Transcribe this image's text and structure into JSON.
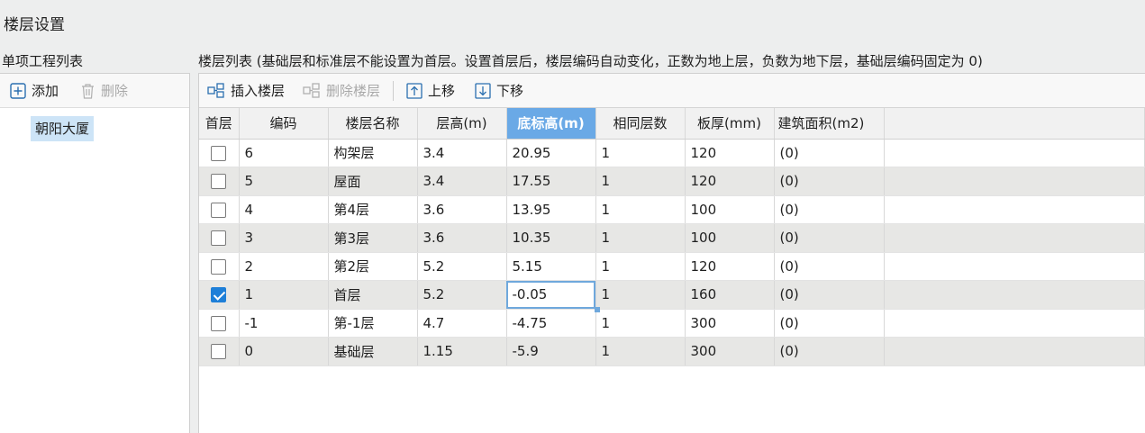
{
  "window": {
    "title": "楼层设置"
  },
  "left": {
    "title": "单项工程列表",
    "toolbar": {
      "add": "添加",
      "delete": "删除"
    },
    "items": [
      "朝阳大厦"
    ]
  },
  "right": {
    "title": "楼层列表 (基础层和标准层不能设置为首层。设置首层后，楼层编码自动变化，正数为地上层，负数为地下层，基础层编码固定为 0)",
    "toolbar": {
      "insert": "插入楼层",
      "delete": "删除楼层",
      "up": "上移",
      "down": "下移"
    },
    "columns": [
      "首层",
      "编码",
      "楼层名称",
      "层高(m)",
      "底标高(m)",
      "相同层数",
      "板厚(mm)",
      "建筑面积(m2)"
    ],
    "rows": [
      {
        "first": false,
        "code": "6",
        "name": "构架层",
        "height": "3.4",
        "base": "20.95",
        "same": "1",
        "slab": "120",
        "area": "(0)"
      },
      {
        "first": false,
        "code": "5",
        "name": "屋面",
        "height": "3.4",
        "base": "17.55",
        "same": "1",
        "slab": "120",
        "area": "(0)"
      },
      {
        "first": false,
        "code": "4",
        "name": "第4层",
        "height": "3.6",
        "base": "13.95",
        "same": "1",
        "slab": "100",
        "area": "(0)"
      },
      {
        "first": false,
        "code": "3",
        "name": "第3层",
        "height": "3.6",
        "base": "10.35",
        "same": "1",
        "slab": "100",
        "area": "(0)"
      },
      {
        "first": false,
        "code": "2",
        "name": "第2层",
        "height": "5.2",
        "base": "5.15",
        "same": "1",
        "slab": "120",
        "area": "(0)"
      },
      {
        "first": true,
        "code": "1",
        "name": "首层",
        "height": "5.2",
        "base": "-0.05",
        "same": "1",
        "slab": "160",
        "area": "(0)"
      },
      {
        "first": false,
        "code": "-1",
        "name": "第-1层",
        "height": "4.7",
        "base": "-4.75",
        "same": "1",
        "slab": "300",
        "area": "(0)"
      },
      {
        "first": false,
        "code": "0",
        "name": "基础层",
        "height": "1.15",
        "base": "-5.9",
        "same": "1",
        "slab": "300",
        "area": "(0)"
      }
    ]
  },
  "colors": {
    "accent": "#1e7fd8",
    "header_selected": "#6aa9e6",
    "selection": "#cde4f7"
  }
}
